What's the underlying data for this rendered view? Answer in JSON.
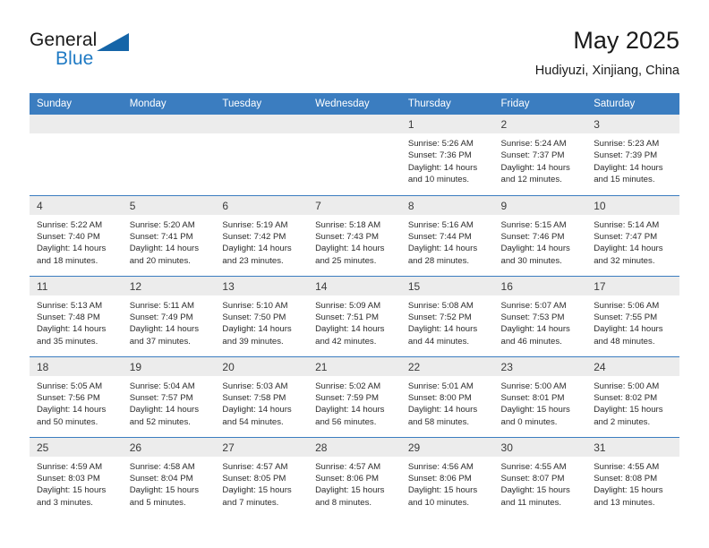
{
  "brand": {
    "word1": "General",
    "word2": "Blue",
    "triangle_color": "#1565a8",
    "blue_color": "#1f7ac4"
  },
  "header": {
    "title": "May 2025",
    "subtitle": "Hudiyuzi, Xinjiang, China"
  },
  "theme": {
    "header_blue": "#3b7dc0",
    "daynum_gray": "#ececec",
    "text": "#2b2b2b"
  },
  "calendar": {
    "weekdays": [
      "Sunday",
      "Monday",
      "Tuesday",
      "Wednesday",
      "Thursday",
      "Friday",
      "Saturday"
    ],
    "weeks": [
      [
        {
          "day": "",
          "empty": true,
          "lines": []
        },
        {
          "day": "",
          "empty": true,
          "lines": []
        },
        {
          "day": "",
          "empty": true,
          "lines": []
        },
        {
          "day": "",
          "empty": true,
          "lines": []
        },
        {
          "day": "1",
          "empty": false,
          "lines": [
            "Sunrise: 5:26 AM",
            "Sunset: 7:36 PM",
            "Daylight: 14 hours",
            "and 10 minutes."
          ]
        },
        {
          "day": "2",
          "empty": false,
          "lines": [
            "Sunrise: 5:24 AM",
            "Sunset: 7:37 PM",
            "Daylight: 14 hours",
            "and 12 minutes."
          ]
        },
        {
          "day": "3",
          "empty": false,
          "lines": [
            "Sunrise: 5:23 AM",
            "Sunset: 7:39 PM",
            "Daylight: 14 hours",
            "and 15 minutes."
          ]
        }
      ],
      [
        {
          "day": "4",
          "empty": false,
          "lines": [
            "Sunrise: 5:22 AM",
            "Sunset: 7:40 PM",
            "Daylight: 14 hours",
            "and 18 minutes."
          ]
        },
        {
          "day": "5",
          "empty": false,
          "lines": [
            "Sunrise: 5:20 AM",
            "Sunset: 7:41 PM",
            "Daylight: 14 hours",
            "and 20 minutes."
          ]
        },
        {
          "day": "6",
          "empty": false,
          "lines": [
            "Sunrise: 5:19 AM",
            "Sunset: 7:42 PM",
            "Daylight: 14 hours",
            "and 23 minutes."
          ]
        },
        {
          "day": "7",
          "empty": false,
          "lines": [
            "Sunrise: 5:18 AM",
            "Sunset: 7:43 PM",
            "Daylight: 14 hours",
            "and 25 minutes."
          ]
        },
        {
          "day": "8",
          "empty": false,
          "lines": [
            "Sunrise: 5:16 AM",
            "Sunset: 7:44 PM",
            "Daylight: 14 hours",
            "and 28 minutes."
          ]
        },
        {
          "day": "9",
          "empty": false,
          "lines": [
            "Sunrise: 5:15 AM",
            "Sunset: 7:46 PM",
            "Daylight: 14 hours",
            "and 30 minutes."
          ]
        },
        {
          "day": "10",
          "empty": false,
          "lines": [
            "Sunrise: 5:14 AM",
            "Sunset: 7:47 PM",
            "Daylight: 14 hours",
            "and 32 minutes."
          ]
        }
      ],
      [
        {
          "day": "11",
          "empty": false,
          "lines": [
            "Sunrise: 5:13 AM",
            "Sunset: 7:48 PM",
            "Daylight: 14 hours",
            "and 35 minutes."
          ]
        },
        {
          "day": "12",
          "empty": false,
          "lines": [
            "Sunrise: 5:11 AM",
            "Sunset: 7:49 PM",
            "Daylight: 14 hours",
            "and 37 minutes."
          ]
        },
        {
          "day": "13",
          "empty": false,
          "lines": [
            "Sunrise: 5:10 AM",
            "Sunset: 7:50 PM",
            "Daylight: 14 hours",
            "and 39 minutes."
          ]
        },
        {
          "day": "14",
          "empty": false,
          "lines": [
            "Sunrise: 5:09 AM",
            "Sunset: 7:51 PM",
            "Daylight: 14 hours",
            "and 42 minutes."
          ]
        },
        {
          "day": "15",
          "empty": false,
          "lines": [
            "Sunrise: 5:08 AM",
            "Sunset: 7:52 PM",
            "Daylight: 14 hours",
            "and 44 minutes."
          ]
        },
        {
          "day": "16",
          "empty": false,
          "lines": [
            "Sunrise: 5:07 AM",
            "Sunset: 7:53 PM",
            "Daylight: 14 hours",
            "and 46 minutes."
          ]
        },
        {
          "day": "17",
          "empty": false,
          "lines": [
            "Sunrise: 5:06 AM",
            "Sunset: 7:55 PM",
            "Daylight: 14 hours",
            "and 48 minutes."
          ]
        }
      ],
      [
        {
          "day": "18",
          "empty": false,
          "lines": [
            "Sunrise: 5:05 AM",
            "Sunset: 7:56 PM",
            "Daylight: 14 hours",
            "and 50 minutes."
          ]
        },
        {
          "day": "19",
          "empty": false,
          "lines": [
            "Sunrise: 5:04 AM",
            "Sunset: 7:57 PM",
            "Daylight: 14 hours",
            "and 52 minutes."
          ]
        },
        {
          "day": "20",
          "empty": false,
          "lines": [
            "Sunrise: 5:03 AM",
            "Sunset: 7:58 PM",
            "Daylight: 14 hours",
            "and 54 minutes."
          ]
        },
        {
          "day": "21",
          "empty": false,
          "lines": [
            "Sunrise: 5:02 AM",
            "Sunset: 7:59 PM",
            "Daylight: 14 hours",
            "and 56 minutes."
          ]
        },
        {
          "day": "22",
          "empty": false,
          "lines": [
            "Sunrise: 5:01 AM",
            "Sunset: 8:00 PM",
            "Daylight: 14 hours",
            "and 58 minutes."
          ]
        },
        {
          "day": "23",
          "empty": false,
          "lines": [
            "Sunrise: 5:00 AM",
            "Sunset: 8:01 PM",
            "Daylight: 15 hours",
            "and 0 minutes."
          ]
        },
        {
          "day": "24",
          "empty": false,
          "lines": [
            "Sunrise: 5:00 AM",
            "Sunset: 8:02 PM",
            "Daylight: 15 hours",
            "and 2 minutes."
          ]
        }
      ],
      [
        {
          "day": "25",
          "empty": false,
          "lines": [
            "Sunrise: 4:59 AM",
            "Sunset: 8:03 PM",
            "Daylight: 15 hours",
            "and 3 minutes."
          ]
        },
        {
          "day": "26",
          "empty": false,
          "lines": [
            "Sunrise: 4:58 AM",
            "Sunset: 8:04 PM",
            "Daylight: 15 hours",
            "and 5 minutes."
          ]
        },
        {
          "day": "27",
          "empty": false,
          "lines": [
            "Sunrise: 4:57 AM",
            "Sunset: 8:05 PM",
            "Daylight: 15 hours",
            "and 7 minutes."
          ]
        },
        {
          "day": "28",
          "empty": false,
          "lines": [
            "Sunrise: 4:57 AM",
            "Sunset: 8:06 PM",
            "Daylight: 15 hours",
            "and 8 minutes."
          ]
        },
        {
          "day": "29",
          "empty": false,
          "lines": [
            "Sunrise: 4:56 AM",
            "Sunset: 8:06 PM",
            "Daylight: 15 hours",
            "and 10 minutes."
          ]
        },
        {
          "day": "30",
          "empty": false,
          "lines": [
            "Sunrise: 4:55 AM",
            "Sunset: 8:07 PM",
            "Daylight: 15 hours",
            "and 11 minutes."
          ]
        },
        {
          "day": "31",
          "empty": false,
          "lines": [
            "Sunrise: 4:55 AM",
            "Sunset: 8:08 PM",
            "Daylight: 15 hours",
            "and 13 minutes."
          ]
        }
      ]
    ]
  }
}
